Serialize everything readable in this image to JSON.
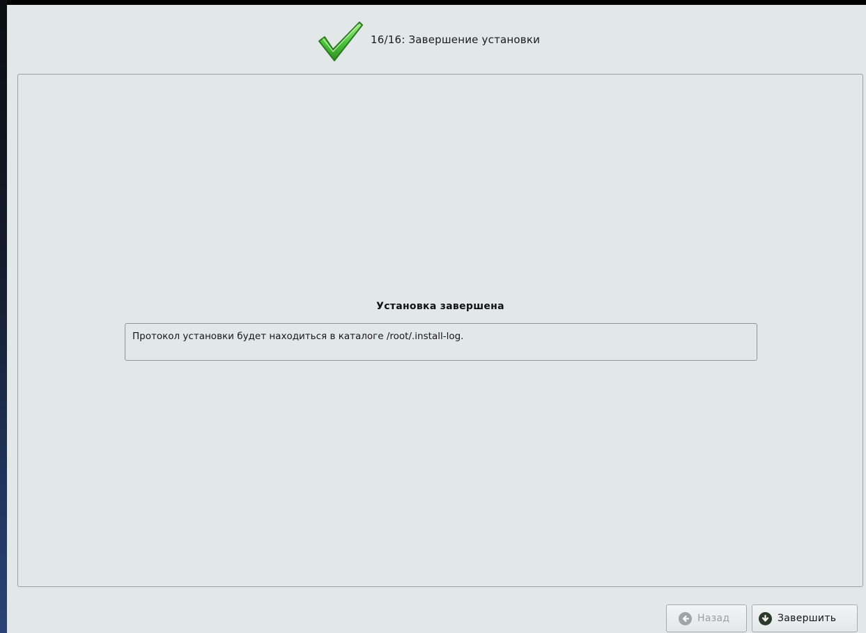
{
  "header": {
    "step_title": "16/16: Завершение установки"
  },
  "main": {
    "heading": "Установка завершена",
    "log_message": "Протокол установки будет находиться в каталоге /root/.install-log."
  },
  "buttons": {
    "back_label": "Назад",
    "finish_label": "Завершить"
  },
  "icons": {
    "header_icon": "check-icon",
    "back_icon": "arrow-left-circle-icon",
    "finish_icon": "arrow-down-circle-icon"
  },
  "colors": {
    "window_bg": "#e2e7e7",
    "check_green": "#4cc23a",
    "disabled_text": "#9aa0a0"
  }
}
